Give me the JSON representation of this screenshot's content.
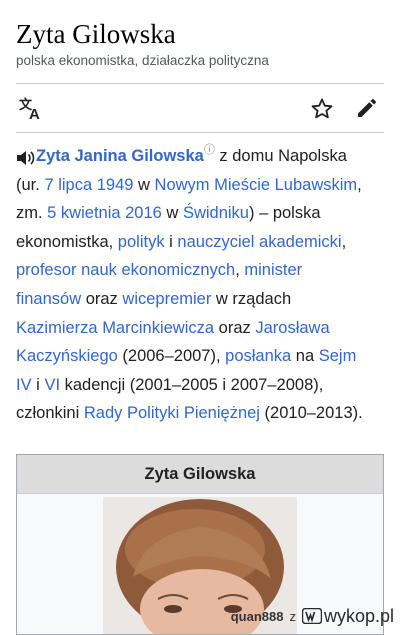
{
  "article": {
    "title": "Zyta Gilowska",
    "subtitle": "polska ekonomistka, działaczka polityczna"
  },
  "toolbar": {
    "icons": [
      "translate-icon",
      "star-icon",
      "pencil-icon"
    ]
  },
  "intro": {
    "audio_icon": "speaker-icon",
    "name": "Zyta Janina Gilowska",
    "info_mark": "ⓘ",
    "lines": [
      [
        {
          "t": "z domu Napolska"
        }
      ],
      [
        {
          "t": "(ur. "
        },
        {
          "t": "7 lipca 1949",
          "l": true
        },
        {
          "t": " w "
        },
        {
          "t": "Nowym Mieście Lubawskim",
          "l": true
        },
        {
          "t": ","
        }
      ],
      [
        {
          "t": "zm. "
        },
        {
          "t": "5 kwietnia 2016",
          "l": true
        },
        {
          "t": " w "
        },
        {
          "t": "Świdniku",
          "l": true
        },
        {
          "t": ") – polska"
        }
      ],
      [
        {
          "t": "ekonomistka, "
        },
        {
          "t": "polityk",
          "l": true
        },
        {
          "t": " i "
        },
        {
          "t": "nauczyciel akademicki",
          "l": true
        },
        {
          "t": ","
        }
      ],
      [
        {
          "t": "profesor nauk ekonomicznych",
          "l": true
        },
        {
          "t": ", "
        },
        {
          "t": "minister",
          "l": true
        }
      ],
      [
        {
          "t": "finansów",
          "l": true
        },
        {
          "t": " oraz "
        },
        {
          "t": "wicepremier",
          "l": true
        },
        {
          "t": " w rządach"
        }
      ],
      [
        {
          "t": "Kazimierza Marcinkiewicza",
          "l": true
        },
        {
          "t": " oraz "
        },
        {
          "t": "Jarosława",
          "l": true
        }
      ],
      [
        {
          "t": "Kaczyńskiego",
          "l": true
        },
        {
          "t": " (2006–2007), "
        },
        {
          "t": "posłanka",
          "l": true
        },
        {
          "t": " na "
        },
        {
          "t": "Sejm",
          "l": true
        }
      ],
      [
        {
          "t": "IV",
          "l": true
        },
        {
          "t": " i "
        },
        {
          "t": "VI",
          "l": true
        },
        {
          "t": " kadencji (2001–2005 i 2007–2008),"
        }
      ],
      [
        {
          "t": "członkini "
        },
        {
          "t": "Rady Polityki Pieniężnej",
          "l": true
        },
        {
          "t": " (2010–2013)."
        }
      ]
    ]
  },
  "infobox": {
    "title": "Zyta Gilowska",
    "image": "portrait-photo"
  },
  "watermark": {
    "user": "quan888",
    "sep": "z",
    "site": "wykop.pl"
  },
  "colors": {
    "link": "#3366cc",
    "text": "#202122",
    "muted": "#54595d",
    "infobox_header": "#dcdcdc"
  }
}
